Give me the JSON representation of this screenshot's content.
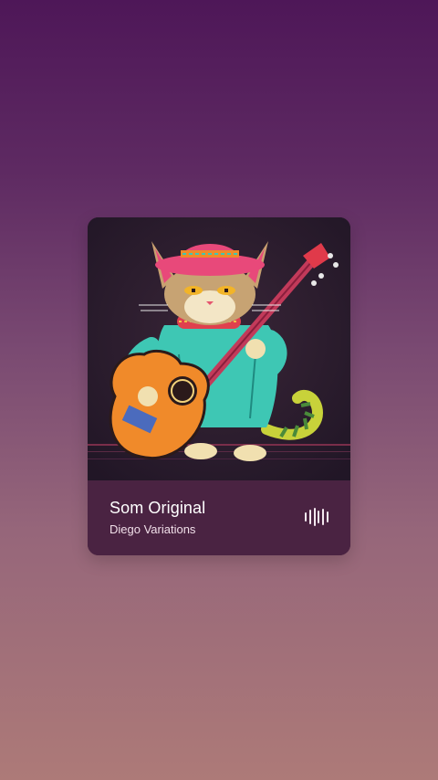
{
  "track": {
    "title": "Som Original",
    "artist": "Diego Variations"
  },
  "icons": {
    "audio_wave": "audio-wave-icon"
  },
  "colors": {
    "background_top": "#4e1758",
    "background_bottom": "#ad7a78",
    "card_info": "#4a2342",
    "title_text": "#ffffff"
  }
}
